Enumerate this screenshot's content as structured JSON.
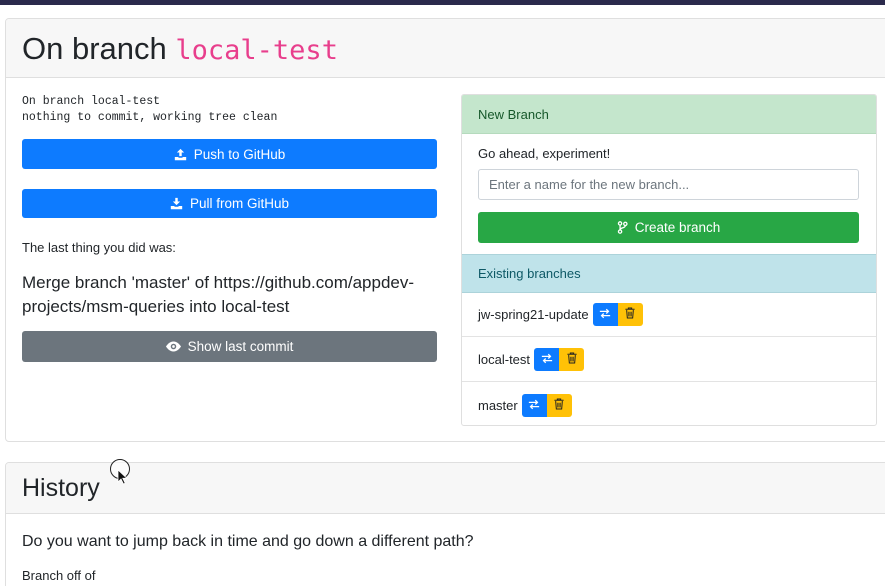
{
  "header": {
    "title_prefix": "On branch",
    "branch_name": "local-test"
  },
  "status": {
    "line1": "On branch local-test",
    "line2": "nothing to commit, working tree clean"
  },
  "actions": {
    "push_label": "Push to GitHub",
    "pull_label": "Pull from GitHub",
    "last_thing_label": "The last thing you did was:",
    "last_commit_message": "Merge branch 'master' of https://github.com/appdev-projects/msm-queries into local-test",
    "show_commit_label": "Show last commit"
  },
  "new_branch": {
    "heading": "New Branch",
    "prompt": "Go ahead, experiment!",
    "input_placeholder": "Enter a name for the new branch...",
    "input_value": "",
    "create_label": "Create branch"
  },
  "existing_branches": {
    "heading": "Existing branches",
    "items": [
      {
        "name": "jw-spring21-update"
      },
      {
        "name": "local-test"
      },
      {
        "name": "master"
      }
    ]
  },
  "history": {
    "title": "History",
    "question": "Do you want to jump back in time and go down a different path?",
    "branch_off_label": "Branch off of"
  },
  "icons": {
    "push": "upload-icon",
    "pull": "download-icon",
    "show": "eye-icon",
    "create": "code-branch-icon",
    "checkout": "exchange-icon",
    "delete": "trash-icon"
  },
  "colors": {
    "primary": "#0d7bff",
    "secondary": "#6c757d",
    "success": "#28a745",
    "warning": "#ffc107",
    "code_pink": "#e83e8c",
    "new_branch_header": "#c4e6cc",
    "existing_header": "#bfe3ea"
  }
}
